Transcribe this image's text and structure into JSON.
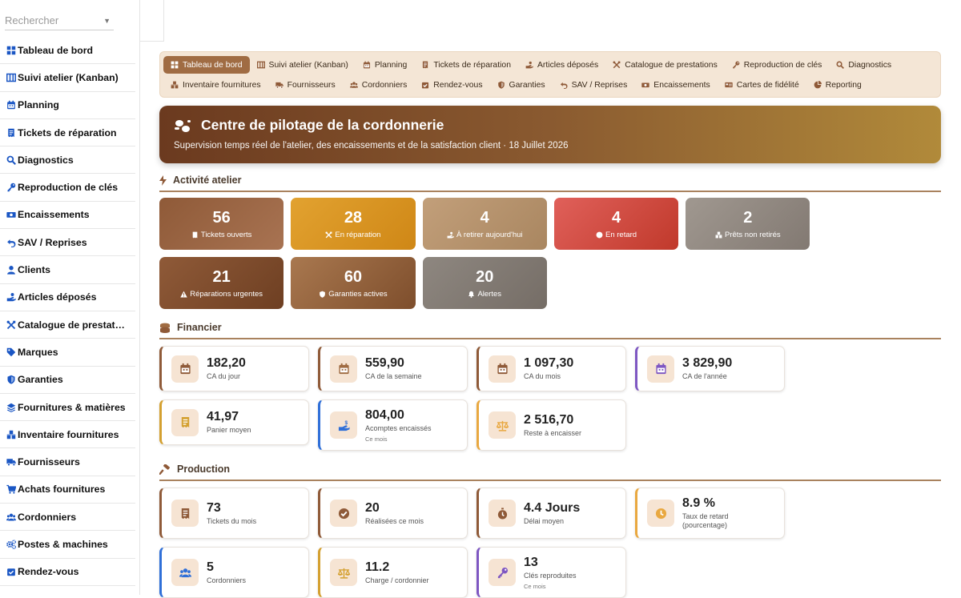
{
  "search": {
    "placeholder": "Rechercher"
  },
  "sidebar": {
    "items": [
      {
        "label": "Tableau de bord",
        "icon": "grid-icon"
      },
      {
        "label": "Suivi atelier (Kanban)",
        "icon": "kanban-icon"
      },
      {
        "label": "Planning",
        "icon": "calendar-icon"
      },
      {
        "label": "Tickets de réparation",
        "icon": "receipt-icon"
      },
      {
        "label": "Diagnostics",
        "icon": "search-icon"
      },
      {
        "label": "Reproduction de clés",
        "icon": "key-icon"
      },
      {
        "label": "Encaissements",
        "icon": "money-icon"
      },
      {
        "label": "SAV / Reprises",
        "icon": "undo-icon"
      },
      {
        "label": "Clients",
        "icon": "user-icon"
      },
      {
        "label": "Articles déposés",
        "icon": "hand-icon"
      },
      {
        "label": "Catalogue de prestat…",
        "icon": "tools-icon"
      },
      {
        "label": "Marques",
        "icon": "tag-icon"
      },
      {
        "label": "Garanties",
        "icon": "shield-icon"
      },
      {
        "label": "Fournitures & matières",
        "icon": "layers-icon"
      },
      {
        "label": "Inventaire fournitures",
        "icon": "boxes-icon"
      },
      {
        "label": "Fournisseurs",
        "icon": "truck-icon"
      },
      {
        "label": "Achats fournitures",
        "icon": "cart-icon"
      },
      {
        "label": "Cordonniers",
        "icon": "users-icon"
      },
      {
        "label": "Postes & machines",
        "icon": "gears-icon"
      },
      {
        "label": "Rendez-vous",
        "icon": "calendar-check-icon"
      }
    ]
  },
  "nav": {
    "row1": [
      {
        "label": "Tableau de bord",
        "icon": "grid-icon",
        "active": true
      },
      {
        "label": "Suivi atelier (Kanban)",
        "icon": "kanban-icon"
      },
      {
        "label": "Planning",
        "icon": "calendar-icon"
      },
      {
        "label": "Tickets de réparation",
        "icon": "receipt-icon"
      },
      {
        "label": "Articles déposés",
        "icon": "hand-icon"
      },
      {
        "label": "Catalogue de prestations",
        "icon": "tools-icon"
      },
      {
        "label": "Reproduction de clés",
        "icon": "key-icon"
      },
      {
        "label": "Diagnostics",
        "icon": "search-icon"
      }
    ],
    "row2": [
      {
        "label": "Inventaire fournitures",
        "icon": "boxes-icon"
      },
      {
        "label": "Fournisseurs",
        "icon": "truck-icon"
      },
      {
        "label": "Cordonniers",
        "icon": "users-icon"
      },
      {
        "label": "Rendez-vous",
        "icon": "calendar-check-icon"
      },
      {
        "label": "Garanties",
        "icon": "shield-icon"
      },
      {
        "label": "SAV / Reprises",
        "icon": "undo-icon"
      },
      {
        "label": "Encaissements",
        "icon": "money-icon"
      },
      {
        "label": "Cartes de fidélité",
        "icon": "card-icon"
      },
      {
        "label": "Reporting",
        "icon": "pie-icon"
      }
    ]
  },
  "hero": {
    "title": "Centre de pilotage de la cordonnerie",
    "subtitle": "Supervision temps réel de l'atelier, des encaissements et de la satisfaction client · 18 Juillet 2026"
  },
  "sections": {
    "activity": "Activité atelier",
    "finance": "Financier",
    "production": "Production"
  },
  "activity": [
    {
      "value": "56",
      "label": "Tickets ouverts",
      "icon": "receipt-icon",
      "color": "#8f5a38",
      "color2": "#a87352"
    },
    {
      "value": "28",
      "label": "En réparation",
      "icon": "tools-icon",
      "color": "#e2a230",
      "color2": "#cf8716"
    },
    {
      "value": "4",
      "label": "À retirer aujourd'hui",
      "icon": "hand-icon",
      "color": "#c29f7a",
      "color2": "#a98660"
    },
    {
      "value": "4",
      "label": "En retard",
      "icon": "clock-icon",
      "color": "#e0605a",
      "color2": "#c0392b"
    },
    {
      "value": "2",
      "label": "Prêts non retirés",
      "icon": "boxes-icon",
      "color": "#a09890",
      "color2": "#827972"
    },
    {
      "value": "21",
      "label": "Réparations urgentes",
      "icon": "warning-icon",
      "color": "#8f5a38",
      "color2": "#6e3f22"
    },
    {
      "value": "60",
      "label": "Garanties actives",
      "icon": "shield-icon",
      "color": "#a9784f",
      "color2": "#7e4e2c"
    },
    {
      "value": "20",
      "label": "Alertes",
      "icon": "bell-icon",
      "color": "#8e8780",
      "color2": "#756d66"
    }
  ],
  "finance": [
    {
      "value": "182,20",
      "label": "CA du jour",
      "sub": "",
      "icon": "calendar-day-icon",
      "border": "#8f5a38",
      "iconcolor": "#8f5a38"
    },
    {
      "value": "559,90",
      "label": "CA de la semaine",
      "sub": "",
      "icon": "calendar-week-icon",
      "border": "#8f5a38",
      "iconcolor": "#a06c43"
    },
    {
      "value": "1 097,30",
      "label": "CA du mois",
      "sub": "",
      "icon": "calendar-month-icon",
      "border": "#8f5a38",
      "iconcolor": "#8f5a38"
    },
    {
      "value": "3 829,90",
      "label": "CA de l'année",
      "sub": "",
      "icon": "calendar-year-icon",
      "border": "#7e57c2",
      "iconcolor": "#7e57c2"
    },
    {
      "value": "41,97",
      "label": "Panier moyen",
      "sub": "",
      "icon": "receipt-icon",
      "border": "#d4a030",
      "iconcolor": "#d4a030"
    },
    {
      "value": "804,00",
      "label": "Acomptes encaissés",
      "sub": "Ce mois",
      "icon": "hand-dollar-icon",
      "border": "#2f6fd8",
      "iconcolor": "#2f6fd8"
    },
    {
      "value": "2 516,70",
      "label": "Reste à encaisser",
      "sub": "",
      "icon": "scale-icon",
      "border": "#e9a840",
      "iconcolor": "#e9a840"
    }
  ],
  "production": [
    {
      "value": "73",
      "label": "Tickets du mois",
      "sub": "",
      "icon": "receipt-icon",
      "border": "#8f5a38",
      "iconcolor": "#8f5a38"
    },
    {
      "value": "20",
      "label": "Réalisées ce mois",
      "sub": "",
      "icon": "check-circle-icon",
      "border": "#8f5a38",
      "iconcolor": "#8f5a38"
    },
    {
      "value": "4.4 Jours",
      "label": "Délai moyen",
      "sub": "",
      "icon": "stopwatch-icon",
      "border": "#8f5a38",
      "iconcolor": "#8f5a38"
    },
    {
      "value": "8.9 %",
      "label": "Taux de retard (pourcentage)",
      "sub": "",
      "icon": "clock-icon",
      "border": "#e9a840",
      "iconcolor": "#e9a840"
    },
    {
      "value": "5",
      "label": "Cordonniers",
      "sub": "",
      "icon": "users-icon",
      "border": "#2f6fd8",
      "iconcolor": "#2f6fd8"
    },
    {
      "value": "11.2",
      "label": "Charge / cordonnier",
      "sub": "",
      "icon": "scale-icon",
      "border": "#d4a030",
      "iconcolor": "#d4a030"
    },
    {
      "value": "13",
      "label": "Clés reproduites",
      "sub": "Ce mois",
      "icon": "key-icon",
      "border": "#7e57c2",
      "iconcolor": "#7e57c2"
    }
  ],
  "colors": {
    "accent": "#a06c43",
    "blue": "#1a56c4",
    "dark": "#4a3a2c"
  }
}
